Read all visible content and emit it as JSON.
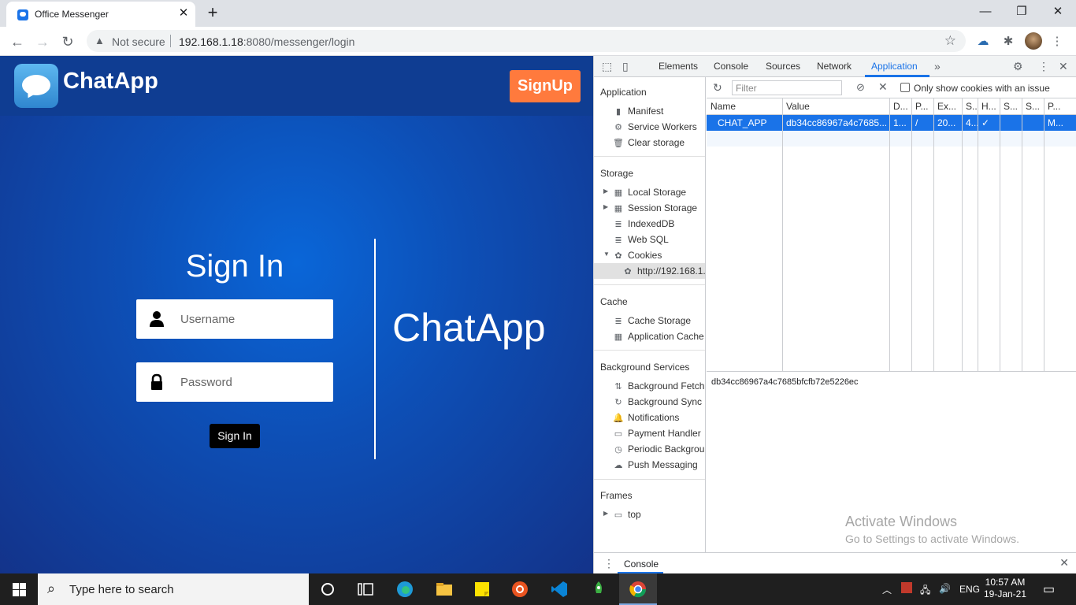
{
  "browser": {
    "tab_title": "Office Messenger",
    "security_label": "Not secure",
    "url_host": "192.168.1.18",
    "url_path": ":8080/messenger/login"
  },
  "page": {
    "brand": "ChatApp",
    "signup_label": "SignUp",
    "signin_title": "Sign In",
    "username_placeholder": "Username",
    "password_placeholder": "Password",
    "signin_button": "Sign In",
    "big_brand": "ChatApp",
    "colors": {
      "accent": "#ff7a3d",
      "background": "#0d4fb6"
    }
  },
  "devtools": {
    "tabs": [
      "Elements",
      "Console",
      "Sources",
      "Network",
      "Application"
    ],
    "active_tab": "Application",
    "sidebar": {
      "application_header": "Application",
      "application_items": [
        "Manifest",
        "Service Workers",
        "Clear storage"
      ],
      "storage_header": "Storage",
      "storage_items": [
        "Local Storage",
        "Session Storage",
        "IndexedDB",
        "Web SQL",
        "Cookies"
      ],
      "cookie_origin": "http://192.168.1.",
      "cache_header": "Cache",
      "cache_items": [
        "Cache Storage",
        "Application Cache"
      ],
      "bg_header": "Background Services",
      "bg_items": [
        "Background Fetch",
        "Background Sync",
        "Notifications",
        "Payment Handler",
        "Periodic Backgrour",
        "Push Messaging"
      ],
      "frames_header": "Frames",
      "frames_items": [
        "top"
      ]
    },
    "filter_placeholder": "Filter",
    "only_issues_label": "Only show cookies with an issue",
    "columns": [
      "Name",
      "Value",
      "D...",
      "P...",
      "Ex...",
      "S..",
      "H...",
      "S...",
      "S...",
      "P..."
    ],
    "rows": [
      [
        "CHAT_APP",
        "db34cc86967a4c7685...",
        "1...",
        "/",
        "20...",
        "4...",
        "✓",
        "",
        "",
        "M..."
      ]
    ],
    "cookie_value": "db34cc86967a4c7685bfcfb72e5226ec",
    "activate_title": "Activate Windows",
    "activate_sub": "Go to Settings to activate Windows.",
    "drawer_tab": "Console"
  },
  "taskbar": {
    "search_placeholder": "Type here to search",
    "lang": "ENG",
    "time": "10:57 AM",
    "date": "19-Jan-21"
  }
}
